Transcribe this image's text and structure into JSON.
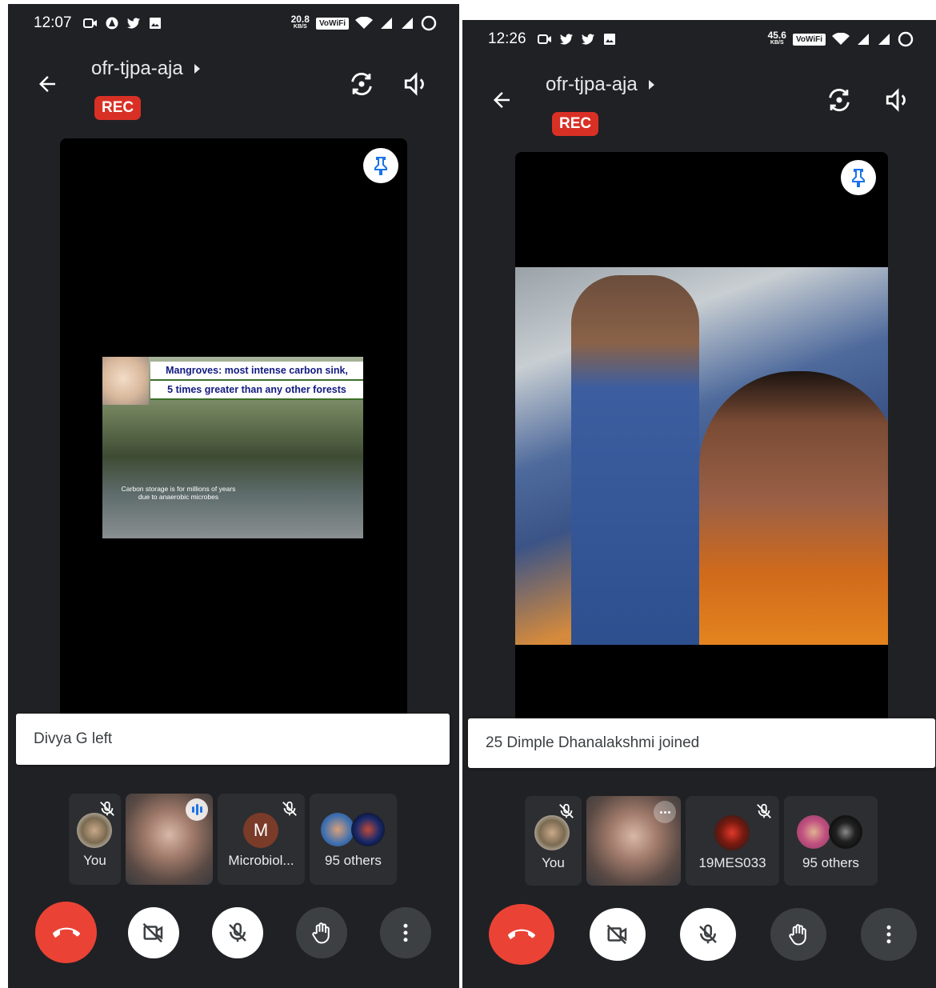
{
  "left": {
    "status": {
      "time": "12:07",
      "speed": "20.8",
      "speed_unit": "KB/S",
      "wifi_label": "VoWiFi"
    },
    "meeting": {
      "code": "ofr-tjpa-aja",
      "rec_badge": "REC"
    },
    "slide": {
      "caption_line1": "Mangroves: most intense carbon sink,",
      "caption_line2": "5 times greater than any other forests",
      "subtext_line1": "Carbon storage is for millions of years",
      "subtext_line2": "due to anaerobic microbes"
    },
    "toast": "Divya G left",
    "participants": [
      {
        "label": "You"
      },
      {
        "label": ""
      },
      {
        "label": "Microbiol...",
        "initial": "M"
      },
      {
        "label": "95 others"
      }
    ]
  },
  "right": {
    "status": {
      "time": "12:26",
      "speed": "45.6",
      "speed_unit": "KB/S",
      "wifi_label": "VoWiFi"
    },
    "meeting": {
      "code": "ofr-tjpa-aja",
      "rec_badge": "REC"
    },
    "toast": "25 Dimple Dhanalakshmi joined",
    "participants": [
      {
        "label": "You"
      },
      {
        "label": ""
      },
      {
        "label": "19MES033"
      },
      {
        "label": "95 others"
      }
    ]
  },
  "colors": {
    "background": "#202124",
    "hangup": "#ea4335",
    "rec": "#d93025",
    "pin": "#1a73e8"
  }
}
